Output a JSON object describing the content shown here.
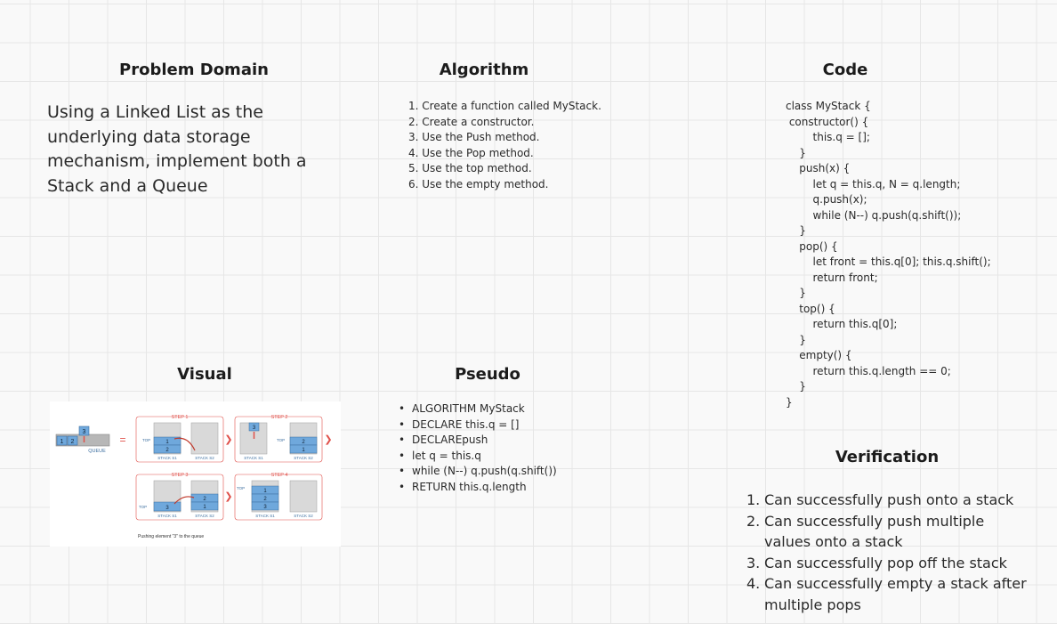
{
  "problem_domain": {
    "title": "Problem Domain",
    "text": "Using a Linked List as the underlying data storage mechanism, implement both a Stack and a Queue"
  },
  "algorithm": {
    "title": "Algorithm",
    "steps": [
      "1. Create a function called MyStack.",
      "2. Create a constructor.",
      "3. Use the Push method.",
      "4. Use the Pop method.",
      "5. Use the top method.",
      "6. Use the empty method."
    ]
  },
  "code": {
    "title": "Code",
    "lines": [
      "class MyStack {",
      " constructor() {",
      "        this.q = [];",
      "    }",
      "    push(x) {",
      "        let q = this.q, N = q.length;",
      "        q.push(x);",
      "        while (N--) q.push(q.shift());",
      "    }",
      "    pop() {",
      "        let front = this.q[0]; this.q.shift();",
      "        return front;",
      "    }",
      "    top() {",
      "        return this.q[0];",
      "    }",
      "    empty() {",
      "        return this.q.length == 0;",
      "    }",
      "}"
    ]
  },
  "visual": {
    "title": "Visual",
    "queue_label": "QUEUE",
    "equals": "=",
    "top_label": "TOP",
    "steps": [
      "STEP 1",
      "STEP 2",
      "STEP 3",
      "STEP 4"
    ],
    "stack1": "STACK S1",
    "stack2": "STACK S2",
    "caption": "Pushing element \"3\" to the queue",
    "queue_values": [
      "1",
      "2",
      "3"
    ],
    "accent_color": "#e0504a",
    "cell_color": "#6fa8dc"
  },
  "pseudo": {
    "title": "Pseudo",
    "items": [
      "ALGORITHM MyStack",
      "DECLARE this.q = []",
      "DECLAREpush",
      "let q = this.q",
      "while (N--) q.push(q.shift())",
      "RETURN this.q.length"
    ]
  },
  "verification": {
    "title": "Verification",
    "items": [
      {
        "num": "1.",
        "text": "Can successfully push onto a stack"
      },
      {
        "num": "2.",
        "text": "Can successfully push multiple values onto a stack"
      },
      {
        "num": "3.",
        "text": "Can successfully pop off the stack"
      },
      {
        "num": "4.",
        "text": "Can successfully empty a stack after multiple pops"
      }
    ]
  }
}
